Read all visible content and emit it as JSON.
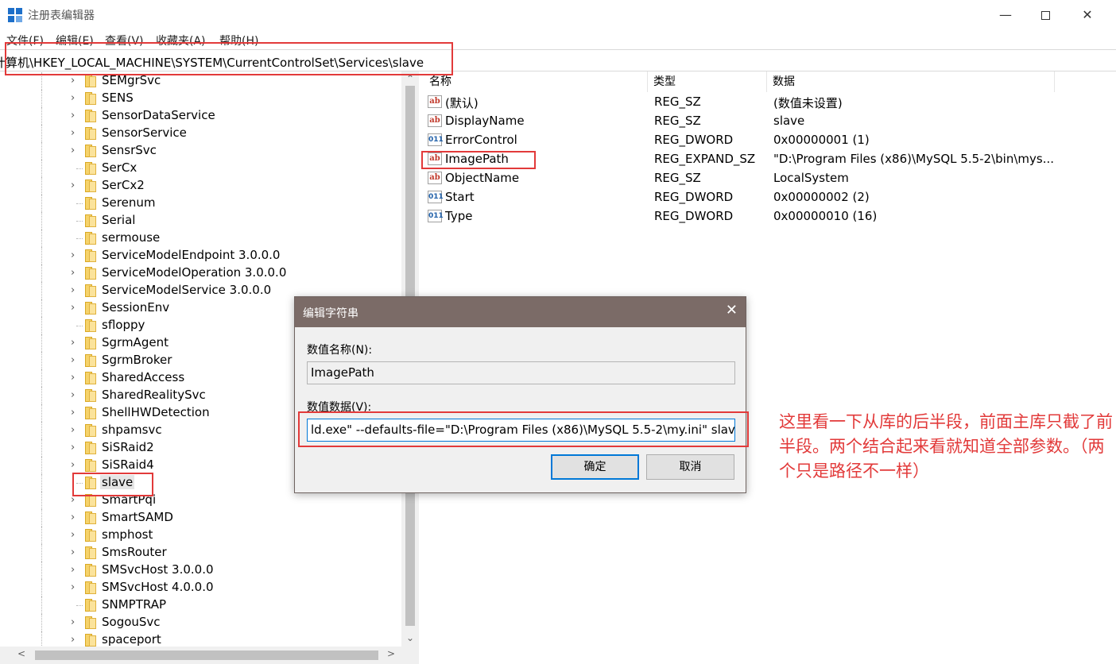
{
  "window": {
    "title": "注册表编辑器",
    "minimize_glyph": "—",
    "close_glyph": "✕"
  },
  "menu": [
    "文件(F)",
    "编辑(E)",
    "查看(V)",
    "收藏夹(A)",
    "帮助(H)"
  ],
  "address": "计算机\\HKEY_LOCAL_MACHINE\\SYSTEM\\CurrentControlSet\\Services\\slave",
  "tree": {
    "items": [
      {
        "label": "SEMgrSvc",
        "expandable": true
      },
      {
        "label": "SENS",
        "expandable": true
      },
      {
        "label": "SensorDataService",
        "expandable": true
      },
      {
        "label": "SensorService",
        "expandable": true
      },
      {
        "label": "SensrSvc",
        "expandable": true
      },
      {
        "label": "SerCx",
        "expandable": false
      },
      {
        "label": "SerCx2",
        "expandable": true
      },
      {
        "label": "Serenum",
        "expandable": false
      },
      {
        "label": "Serial",
        "expandable": false
      },
      {
        "label": "sermouse",
        "expandable": false
      },
      {
        "label": "ServiceModelEndpoint 3.0.0.0",
        "expandable": true
      },
      {
        "label": "ServiceModelOperation 3.0.0.0",
        "expandable": true
      },
      {
        "label": "ServiceModelService 3.0.0.0",
        "expandable": true
      },
      {
        "label": "SessionEnv",
        "expandable": true
      },
      {
        "label": "sfloppy",
        "expandable": false
      },
      {
        "label": "SgrmAgent",
        "expandable": true
      },
      {
        "label": "SgrmBroker",
        "expandable": true
      },
      {
        "label": "SharedAccess",
        "expandable": true
      },
      {
        "label": "SharedRealitySvc",
        "expandable": true
      },
      {
        "label": "ShellHWDetection",
        "expandable": true
      },
      {
        "label": "shpamsvc",
        "expandable": true
      },
      {
        "label": "SiSRaid2",
        "expandable": true
      },
      {
        "label": "SiSRaid4",
        "expandable": true
      },
      {
        "label": "slave",
        "expandable": false,
        "selected": true
      },
      {
        "label": "SmartPqi",
        "expandable": true
      },
      {
        "label": "SmartSAMD",
        "expandable": true
      },
      {
        "label": "smphost",
        "expandable": true
      },
      {
        "label": "SmsRouter",
        "expandable": true
      },
      {
        "label": "SMSvcHost 3.0.0.0",
        "expandable": true
      },
      {
        "label": "SMSvcHost 4.0.0.0",
        "expandable": true
      },
      {
        "label": "SNMPTRAP",
        "expandable": false
      },
      {
        "label": "SogouSvc",
        "expandable": true
      },
      {
        "label": "spaceport",
        "expandable": true
      }
    ]
  },
  "values": {
    "headers": {
      "name": "名称",
      "type": "类型",
      "data": "数据"
    },
    "rows": [
      {
        "icon": "string-value-icon",
        "glyph": "ab",
        "name": "(默认)",
        "type": "REG_SZ",
        "data": "(数值未设置)"
      },
      {
        "icon": "string-value-icon",
        "glyph": "ab",
        "name": "DisplayName",
        "type": "REG_SZ",
        "data": "slave"
      },
      {
        "icon": "binary-value-icon",
        "glyph": "011",
        "name": "ErrorControl",
        "type": "REG_DWORD",
        "data": "0x00000001 (1)"
      },
      {
        "icon": "string-value-icon",
        "glyph": "ab",
        "name": "ImagePath",
        "type": "REG_EXPAND_SZ",
        "data": "\"D:\\Program Files (x86)\\MySQL 5.5-2\\bin\\mys..."
      },
      {
        "icon": "string-value-icon",
        "glyph": "ab",
        "name": "ObjectName",
        "type": "REG_SZ",
        "data": "LocalSystem"
      },
      {
        "icon": "binary-value-icon",
        "glyph": "011",
        "name": "Start",
        "type": "REG_DWORD",
        "data": "0x00000002 (2)"
      },
      {
        "icon": "binary-value-icon",
        "glyph": "011",
        "name": "Type",
        "type": "REG_DWORD",
        "data": "0x00000010 (16)"
      }
    ]
  },
  "dialog": {
    "title": "编辑字符串",
    "close_glyph": "✕",
    "name_label": "数值名称(N):",
    "name_value": "ImagePath",
    "data_label": "数值数据(V):",
    "data_value": "ld.exe\" --defaults-file=\"D:\\Program Files (x86)\\MySQL 5.5-2\\my.ini\" slave",
    "ok_label": "确定",
    "cancel_label": "取消"
  },
  "annotation": {
    "text": "这里看一下从库的后半段，前面主库只截了前半段。两个结合起来看就知道全部参数。（两个只是路径不一样）",
    "color": "#e23a3a"
  },
  "scroll": {
    "up": "⌃",
    "down": "⌄",
    "left": "<",
    "right": ">"
  }
}
